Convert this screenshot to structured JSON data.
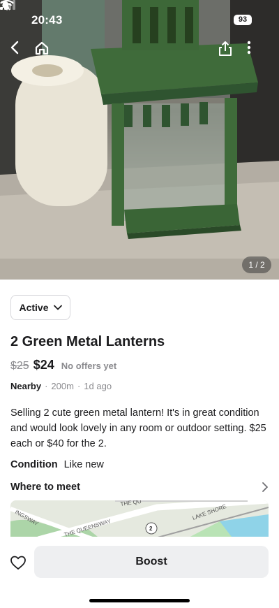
{
  "status_bar": {
    "time": "20:43",
    "battery": "93"
  },
  "photo": {
    "counter": "1 / 2",
    "alt": "Green metal lantern on balcony"
  },
  "nav": {
    "back_icon": "chevron-left-icon",
    "home_icon": "home-icon",
    "share_icon": "share-icon",
    "more_icon": "more-vertical-icon"
  },
  "listing": {
    "status": "Active",
    "title": "2 Green Metal Lanterns",
    "old_price": "$25",
    "price": "$24",
    "offers": "No offers yet",
    "location": "Nearby",
    "distance": "200m",
    "posted": "1d ago",
    "separator": "·",
    "description": "Selling 2 cute green metal lantern! It's in great condition and would look lovely in any room or outdoor setting. $25 each or $40 for the 2.",
    "condition_label": "Condition",
    "condition_value": "Like new",
    "meet_label": "Where to meet"
  },
  "map": {
    "labels": [
      "INGSWAY",
      "THE QUEENSWAY",
      "THE QU",
      "LAKE SHORE",
      "2"
    ]
  },
  "bottom": {
    "boost_label": "Boost"
  },
  "colors": {
    "lantern_green": "#3f6b3a",
    "accent_text": "#1c1c1e",
    "muted_text": "#8a8a8e",
    "button_bg": "#eeeff1"
  }
}
